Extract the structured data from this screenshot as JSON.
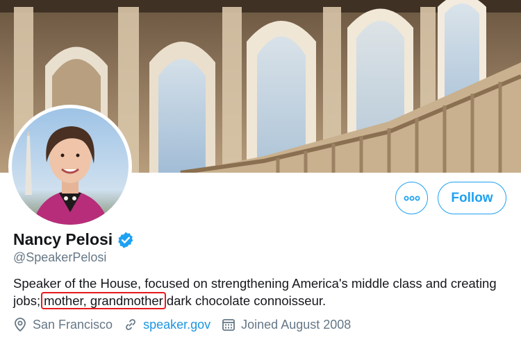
{
  "profile": {
    "name": "Nancy Pelosi",
    "handle": "@SpeakerPelosi",
    "verified": true,
    "bio_before": "Speaker of the House, focused on strengthening America's middle class and creating jobs;",
    "bio_highlight": "mother, grandmother",
    "bio_after": "dark chocolate connoisseur.",
    "location": "San Francisco",
    "website": "speaker.gov",
    "joined": "Joined August 2008"
  },
  "actions": {
    "follow_label": "Follow"
  },
  "icons": {
    "more": "more-options-icon",
    "verified": "verified-badge-icon",
    "location": "location-pin-icon",
    "link": "link-icon",
    "calendar": "calendar-icon"
  },
  "colors": {
    "accent": "#1da1f2",
    "link": "#1b95e0",
    "secondary_text": "#657786",
    "highlight_box": "#e8191c"
  }
}
